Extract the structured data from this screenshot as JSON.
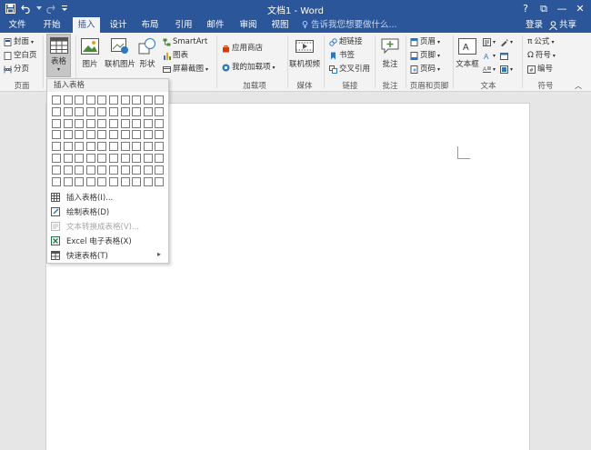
{
  "window": {
    "title": "文档1 - Word",
    "help_btn": "?",
    "restore_btn": "⧉",
    "min_btn": "—",
    "max_btn": "☐",
    "close_btn": "✕"
  },
  "tabs": [
    {
      "label": "文件"
    },
    {
      "label": "开始"
    },
    {
      "label": "插入",
      "active": true
    },
    {
      "label": "设计"
    },
    {
      "label": "布局"
    },
    {
      "label": "引用"
    },
    {
      "label": "邮件"
    },
    {
      "label": "审阅"
    },
    {
      "label": "视图"
    }
  ],
  "tell_me": "♀ 告诉我您想要做什么...",
  "signin": "登录",
  "share": "共享",
  "ribbon": {
    "pages": {
      "cover": "封面",
      "blank": "空白页",
      "break": "分页",
      "label": "页面"
    },
    "table": {
      "label": "表格"
    },
    "illustrations": {
      "picture": "图片",
      "online_picture": "联机图片",
      "shapes": "形状",
      "smartart": "SmartArt",
      "chart": "图表",
      "screenshot": "屏幕截图"
    },
    "addins": {
      "store": "应用商店",
      "my_addins": "我的加载项",
      "label": "加载项"
    },
    "media": {
      "online_video": "联机视频",
      "label": "媒体"
    },
    "links": {
      "hyperlink": "超链接",
      "bookmark": "书签",
      "cross_ref": "交叉引用",
      "label": "链接"
    },
    "comments": {
      "comment": "批注",
      "label": "批注"
    },
    "header_footer": {
      "header": "页眉",
      "footer": "页脚",
      "page_number": "页码",
      "label": "页眉和页脚"
    },
    "text": {
      "textbox": "文本框",
      "label": "文本"
    },
    "symbols": {
      "equation": "公式",
      "symbol": "符号",
      "number": "编号",
      "label": "符号"
    }
  },
  "table_menu": {
    "header": "插入表格",
    "grid_cols": 10,
    "grid_rows": 8,
    "items": [
      {
        "label": "插入表格(I)...",
        "disabled": false
      },
      {
        "label": "绘制表格(D)",
        "disabled": false
      },
      {
        "label": "文本转换成表格(V)...",
        "disabled": true
      },
      {
        "label": "Excel 电子表格(X)",
        "disabled": false
      },
      {
        "label": "快速表格(T)",
        "disabled": false,
        "submenu": true
      }
    ]
  },
  "colors": {
    "accent": "#2b579a",
    "ribbon_bg": "#f3f3f3",
    "workspace_bg": "#e6e6e6"
  }
}
